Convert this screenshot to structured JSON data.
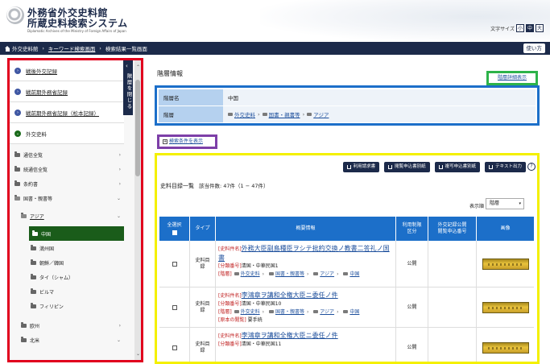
{
  "header": {
    "logo_line1": "外務省外交史料館",
    "logo_line2": "所蔵史料検索システム",
    "logo_sub": "Diplomatic Archives of the Ministry of Foreign Affairs of Japan",
    "fontsize_label": "文字サイズ",
    "fontsize_small": "小",
    "fontsize_medium": "中",
    "fontsize_large": "大"
  },
  "breadcrumb": {
    "home": "外交史料館",
    "keyword_search": "キーワード検索画面",
    "current": "検索結果一覧画面",
    "help": "使い方"
  },
  "sidebar": {
    "toggle_label": "階層を閉じる",
    "top_items": [
      {
        "label": "戦後外交記録"
      },
      {
        "label": "戦前期外務省記録"
      },
      {
        "label": "戦前期外務省記録（松本記録）"
      },
      {
        "label": "外交史料"
      }
    ],
    "tree": [
      {
        "label": "通信全覧",
        "level": 1,
        "state": "closed"
      },
      {
        "label": "続通信全覧",
        "level": 1,
        "state": "closed"
      },
      {
        "label": "条約書",
        "level": 1,
        "state": "closed"
      },
      {
        "label": "国書・親書等",
        "level": 1,
        "state": "open"
      },
      {
        "label": "アジア",
        "level": 2,
        "state": "open"
      },
      {
        "label": "中国",
        "level": 3,
        "state": "selected"
      },
      {
        "label": "満州国",
        "level": 3,
        "state": "leaf"
      },
      {
        "label": "朝鮮／韓国",
        "level": 3,
        "state": "leaf"
      },
      {
        "label": "タイ（シャム）",
        "level": 3,
        "state": "leaf"
      },
      {
        "label": "ビルマ",
        "level": 3,
        "state": "leaf"
      },
      {
        "label": "フィリピン",
        "level": 3,
        "state": "leaf"
      },
      {
        "label": "欧州",
        "level": 2,
        "state": "closed"
      },
      {
        "label": "北米",
        "level": 2,
        "state": "closed"
      }
    ]
  },
  "hierarchy": {
    "title": "階層情報",
    "detail_link": "階層詳細表示",
    "name_label": "階層名",
    "name_value": "中国",
    "path_label": "階層",
    "path": [
      "外交史料",
      "国書・親書等",
      "アジア"
    ]
  },
  "search_conditions": "検索条件を表示",
  "results": {
    "buttons": [
      "利用請求書",
      "閲覧申込書別紙",
      "複写申込書別紙",
      "テキスト出力"
    ],
    "help": "?",
    "list_title": "史料目録一覧",
    "count_text": "該当件数: 47件（1 − 47件）",
    "sort_label": "表示順",
    "sort_value": "階層",
    "columns": {
      "select_all": "全選択",
      "type": "タイプ",
      "summary": "概要情報",
      "restriction_1": "利用制限",
      "restriction_2": "区分",
      "disclosure_1": "外交記録公開",
      "disclosure_2": "閲覧申込番号",
      "image": "画像"
    },
    "rows": [
      {
        "type_1": "史料目",
        "type_2": "録",
        "title_tag": "[史料件名]",
        "title": "外務大臣副島種臣ヲシテ批約交換ノ教書二答礼ノ国書",
        "class_tag": "[分類番号]",
        "class_value": "清国・中華民国1",
        "hier_tag": "[階層]",
        "hier_path": [
          "外交史料",
          "国書・親書等",
          "アジア",
          "中国"
        ],
        "extra_tag": "",
        "extra_value": "",
        "restriction": "公開"
      },
      {
        "type_1": "史料目",
        "type_2": "録",
        "title_tag": "[史料件名]",
        "title": "李鴻章ヲ講和全権大臣ニ委任ノ件",
        "class_tag": "[分類番号]",
        "class_value": "清国・中華民国10",
        "hier_tag": "[階層]",
        "hier_path": [
          "外交史料",
          "国書・親書等",
          "アジア",
          "中国"
        ],
        "extra_tag": "[原本の閲覧]",
        "extra_value": "要手続",
        "restriction": "公開"
      },
      {
        "type_1": "史料目",
        "type_2": "録",
        "title_tag": "[史料件名]",
        "title": "李鴻章ヲ講和全権大臣ニ委任ノ件",
        "class_tag": "[分類番号]",
        "class_value": "清国・中華民国11",
        "hier_tag": "",
        "hier_path": [],
        "extra_tag": "",
        "extra_value": "",
        "restriction": "公開"
      }
    ]
  },
  "colors": {
    "navy": "#1c2a4a",
    "table_header_blue": "#1c6fc9",
    "selected_green": "#1a5c1a",
    "highlight_red": "#e1001e",
    "highlight_blue": "#1c6fc9",
    "highlight_green": "#2db34a",
    "highlight_purple": "#7d3fa8",
    "highlight_yellow": "#f4f000"
  }
}
